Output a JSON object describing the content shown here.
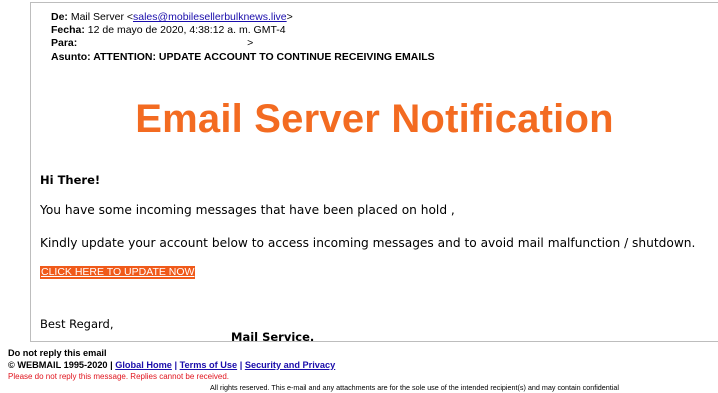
{
  "header": {
    "from_label": "De:",
    "from_name": "Mail Server <",
    "from_email": "sales@mobilesellerbulknews.live",
    "from_close": ">",
    "date_label": "Fecha:",
    "date_value": "12 de mayo de 2020, 4:38:12 a. m. GMT-4",
    "to_label": "Para:",
    "to_value": ">",
    "subject_label": "Asunto:",
    "subject_value": "ATTENTION: UPDATE ACCOUNT TO CONTINUE RECEIVING EMAILS"
  },
  "body": {
    "headline": "Email Server Notification",
    "greeting": "Hi There!",
    "paragraph1": "You have some incoming messages that have been placed on hold  ,",
    "paragraph2": "Kindly update your account below to access incoming messages and to avoid mail malfunction / shutdown.",
    "cta_link": "CLICK HERE TO UPDATE NOW",
    "regards": "Best Regard,",
    "signer": "Mail Service."
  },
  "footer": {
    "no_reply": "Do not reply this email",
    "copyright": "© WEBMAIL 1995-2020 |",
    "link_home": "Global Home",
    "sep1": "|",
    "link_terms": "Terms of Use",
    "sep2": "|",
    "link_security": "Security and Privacy",
    "red_note": "Please do not reply this message. Replies cannot be received.",
    "rights": "All rights reserved. This e-mail and any attachments are for the sole use of the intended recipient(s) and may contain confidential"
  },
  "colors": {
    "headline": "#f36b21",
    "cta_background": "#f05a1a",
    "link": "#1a0dab",
    "warning_red": "#e0141e"
  }
}
